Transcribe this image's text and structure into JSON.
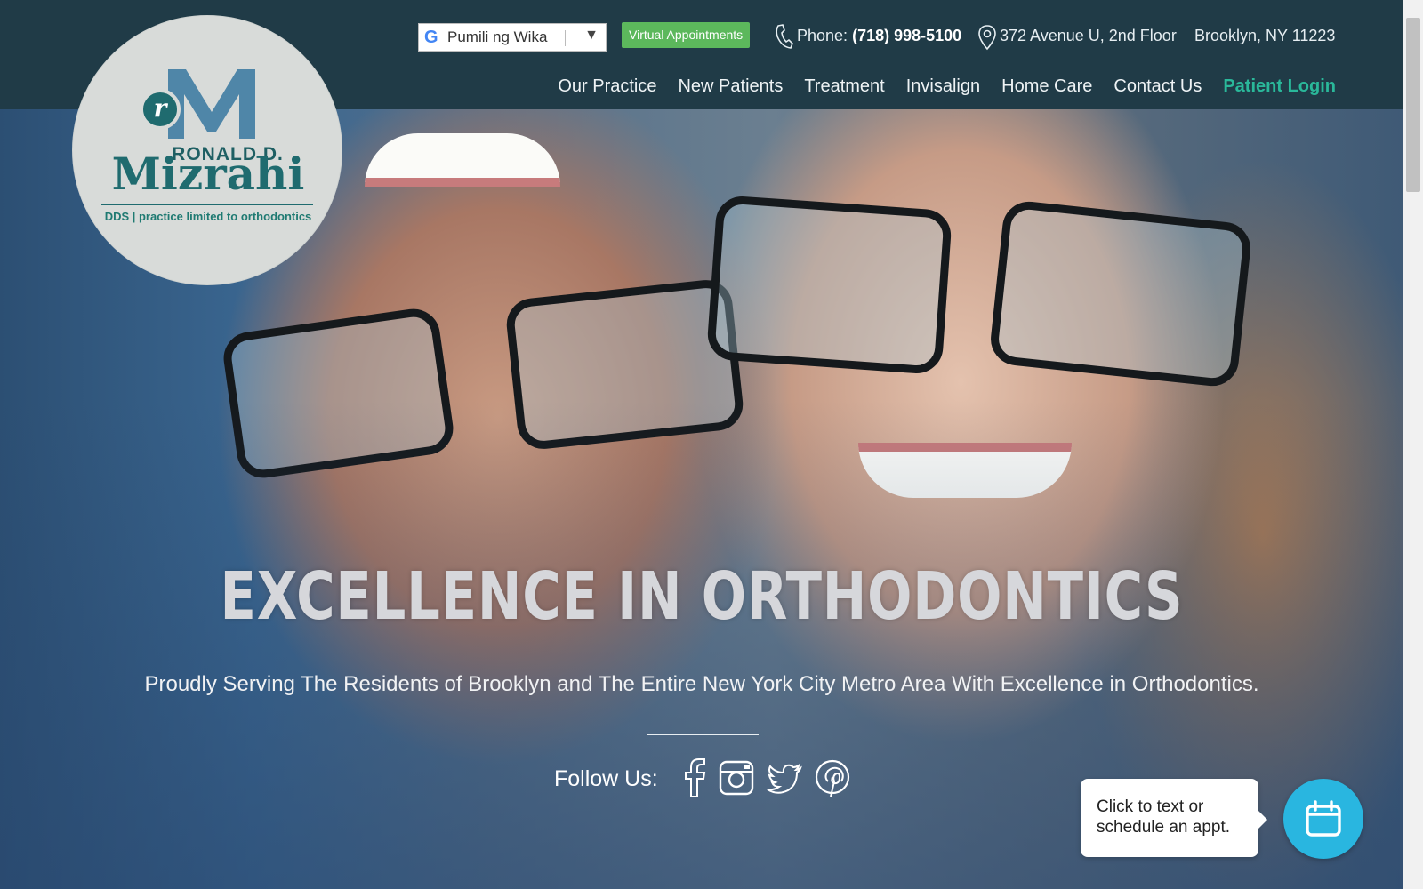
{
  "header": {
    "language_select": {
      "value": "Pumili ng Wika",
      "icon": "google-icon"
    },
    "virtual_appointments_label": "Virtual Appointments",
    "phone_label": "Phone:",
    "phone_number": "(718) 998-5100",
    "address_line1": "372 Avenue U, 2nd Floor",
    "address_line2": "Brooklyn, NY 11223"
  },
  "logo": {
    "monogram": "r",
    "first_name": "RONALD D.",
    "last_name": "Mizrahi",
    "subtitle": "DDS | practice limited to orthodontics"
  },
  "nav": {
    "items": [
      {
        "label": "Our Practice"
      },
      {
        "label": "New Patients"
      },
      {
        "label": "Treatment"
      },
      {
        "label": "Invisalign"
      },
      {
        "label": "Home Care"
      },
      {
        "label": "Contact Us"
      },
      {
        "label": "Patient Login"
      }
    ]
  },
  "hero": {
    "headline": "EXCELLENCE IN ORTHODONTICS",
    "subline": "Proudly Serving The Residents of Brooklyn and The Entire New York City Metro Area With Excellence in Orthodontics.",
    "follow_label": "Follow Us:",
    "social": [
      "facebook-icon",
      "instagram-icon",
      "twitter-icon",
      "pinterest-icon"
    ]
  },
  "chat": {
    "bubble_text": "Click to text or schedule an appt.",
    "button_icon": "calendar-icon"
  },
  "colors": {
    "header_bg": "#203b47",
    "accent_green": "#5cb85c",
    "login_teal": "#2ab89a",
    "logo_teal": "#1f6b6f",
    "chat_blue": "#29b6e0"
  }
}
